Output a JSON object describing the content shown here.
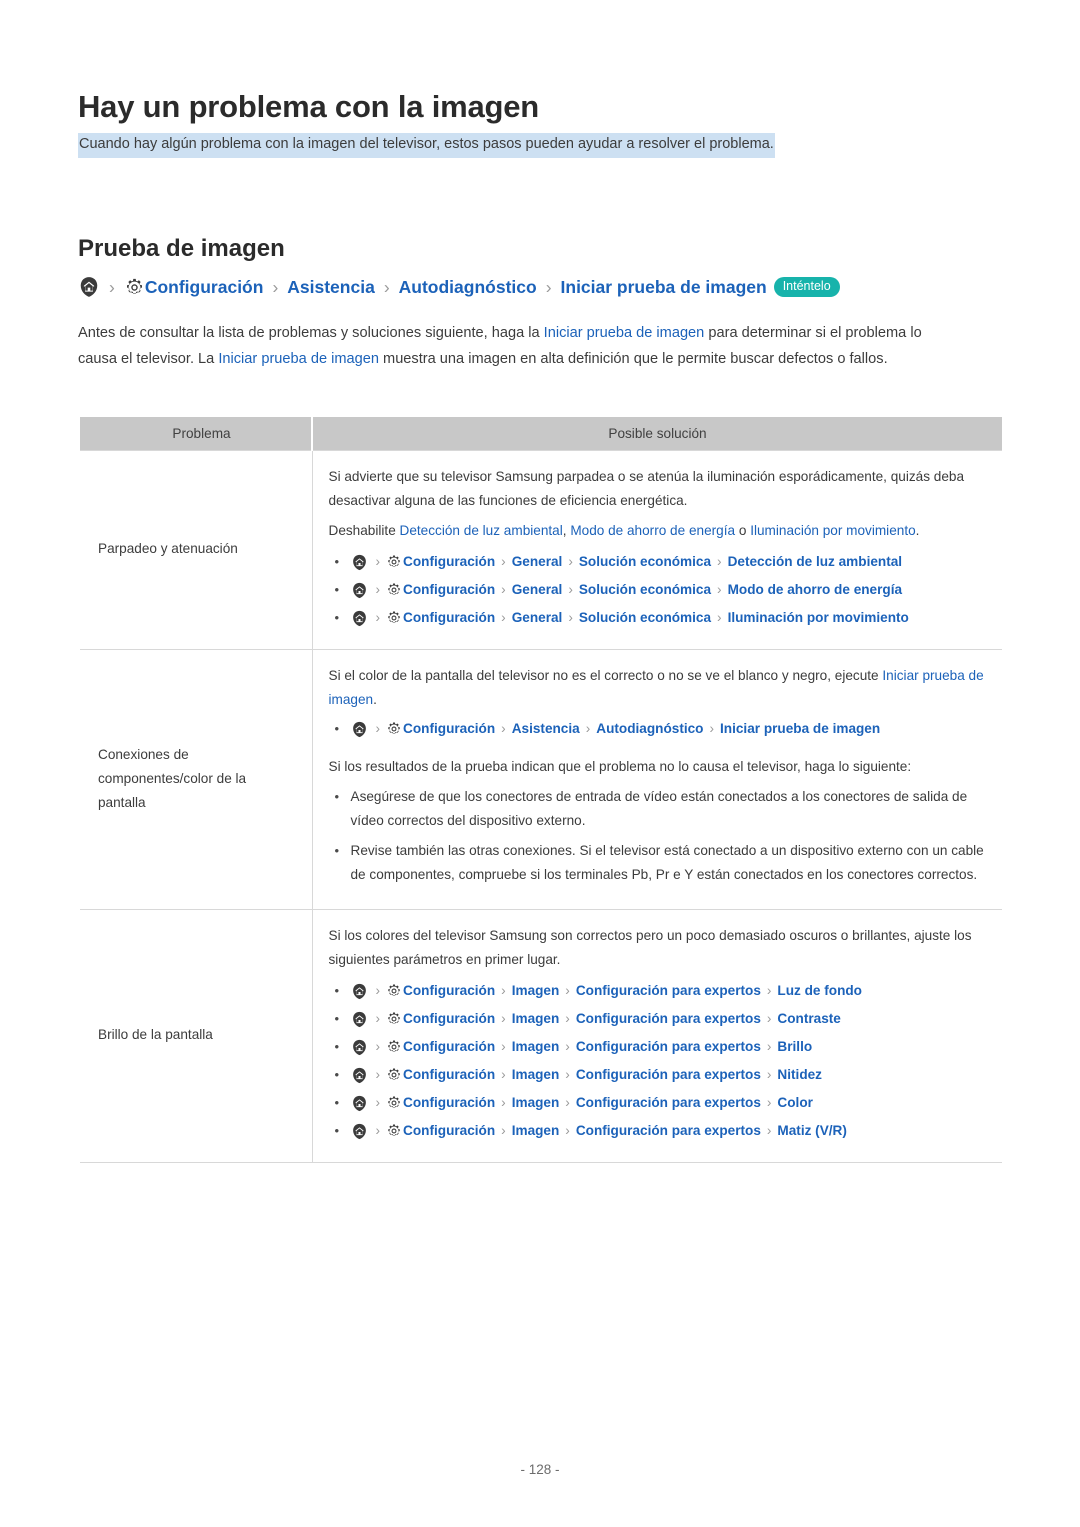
{
  "document": {
    "title": "Hay un problema con la imagen",
    "subtitle": "Cuando hay algún problema con la imagen del televisor, estos pasos pueden ayudar a resolver el problema.",
    "section_heading": "Prueba de imagen",
    "page_number": "- 128 -"
  },
  "colors": {
    "link": "#1c62b9",
    "badge": "#17b3ab",
    "highlight": "#cde0f2",
    "table_header": "#c8c8c8"
  },
  "main_breadcrumb": {
    "home_icon": "home-icon",
    "gear_icon": "gear-icon",
    "separator": "›",
    "items": [
      "Configuración",
      "Asistencia",
      "Autodiagnóstico",
      "Iniciar prueba de imagen"
    ],
    "badge": "Inténtelo"
  },
  "intro": {
    "p1_a": "Antes de consultar la lista de problemas y soluciones siguiente, haga la ",
    "p1_link1": "Iniciar prueba de imagen",
    "p1_b": " para determinar si el problema lo causa el televisor. La ",
    "p1_link2": "Iniciar prueba de imagen",
    "p1_c": " muestra una imagen en alta definición que le permite buscar defectos o fallos."
  },
  "table": {
    "headers": [
      "Problema",
      "Posible solución"
    ],
    "rows": [
      {
        "problem": "Parpadeo y atenuación",
        "para1": "Si advierte que su televisor Samsung parpadea o se atenúa la iluminación esporádicamente, quizás deba desactivar alguna de las funciones de eficiencia energética.",
        "para2_a": "Deshabilite ",
        "para2_link1": "Detección de luz ambiental",
        "para2_b": ", ",
        "para2_link2": "Modo de ahorro de energía",
        "para2_c": " o ",
        "para2_link3": "Iluminación por movimiento",
        "para2_d": ".",
        "paths": [
          [
            "Configuración",
            "General",
            "Solución económica",
            "Detección de luz ambiental"
          ],
          [
            "Configuración",
            "General",
            "Solución económica",
            "Modo de ahorro de energía"
          ],
          [
            "Configuración",
            "General",
            "Solución económica",
            "Iluminación por movimiento"
          ]
        ]
      },
      {
        "problem": "Conexiones de componentes/color de la pantalla",
        "para1_a": "Si el color de la pantalla del televisor no es el correcto o no se ve el blanco y negro, ejecute ",
        "para1_link": "Iniciar prueba de imagen",
        "para1_b": ".",
        "paths": [
          [
            "Configuración",
            "Asistencia",
            "Autodiagnóstico",
            "Iniciar prueba de imagen"
          ]
        ],
        "para2": "Si los resultados de la prueba indican que el problema no lo causa el televisor, haga lo siguiente:",
        "bullets": [
          "Asegúrese de que los conectores de entrada de vídeo están conectados a los conectores de salida de vídeo correctos del dispositivo externo.",
          "Revise también las otras conexiones. Si el televisor está conectado a un dispositivo externo con un cable de componentes, compruebe si los terminales Pb, Pr e Y están conectados en los conectores correctos."
        ]
      },
      {
        "problem": "Brillo de la pantalla",
        "para1": "Si los colores del televisor Samsung son correctos pero un poco demasiado oscuros o brillantes, ajuste los siguientes parámetros en primer lugar.",
        "paths": [
          [
            "Configuración",
            "Imagen",
            "Configuración para expertos",
            "Luz de fondo"
          ],
          [
            "Configuración",
            "Imagen",
            "Configuración para expertos",
            "Contraste"
          ],
          [
            "Configuración",
            "Imagen",
            "Configuración para expertos",
            "Brillo"
          ],
          [
            "Configuración",
            "Imagen",
            "Configuración para expertos",
            "Nitidez"
          ],
          [
            "Configuración",
            "Imagen",
            "Configuración para expertos",
            "Color"
          ],
          [
            "Configuración",
            "Imagen",
            "Configuración para expertos",
            "Matiz (V/R)"
          ]
        ]
      }
    ]
  }
}
